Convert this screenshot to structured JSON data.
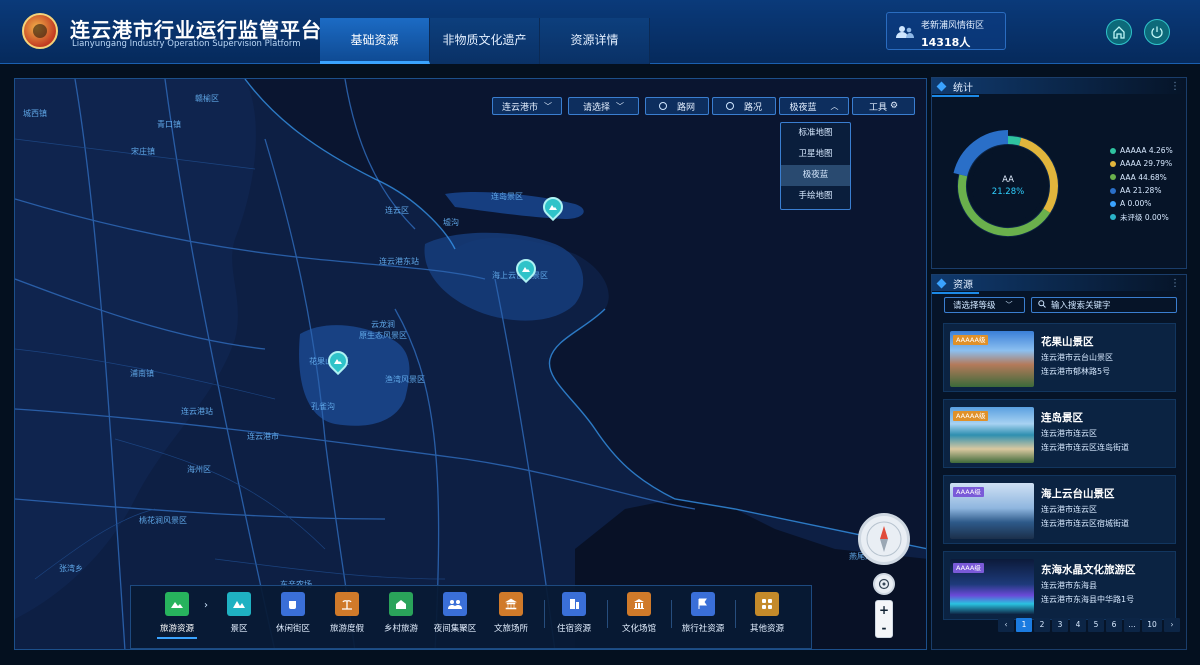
{
  "header": {
    "title": "连云港市行业运行监管平台",
    "subtitle": "Lianyungang Industry Operation Supervision Platform",
    "tabs": [
      {
        "label": "基础资源",
        "active": true
      },
      {
        "label": "非物质文化遗产",
        "active": false
      },
      {
        "label": "资源详情",
        "active": false
      }
    ],
    "visitor_box": {
      "label": "老新浦风情街区",
      "count": "14318人"
    },
    "icons": [
      "home-icon",
      "power-icon"
    ]
  },
  "map": {
    "controls": {
      "city_select": "连云港市",
      "area_select": "请选择",
      "road_net": "路网",
      "road_status": "路况",
      "map_style": "极夜蓝",
      "tools": "工具"
    },
    "style_options": [
      {
        "label": "标准地图",
        "selected": false
      },
      {
        "label": "卫星地图",
        "selected": false
      },
      {
        "label": "极夜蓝",
        "selected": true
      },
      {
        "label": "手绘地图",
        "selected": false
      }
    ],
    "places": [
      "赣榆区",
      "城西镇",
      "青口镇",
      "宋庄镇",
      "墟沟",
      "连岛景区",
      "连云区",
      "连云港东站",
      "海上云台山景区",
      "云龙涧",
      "原生态风景区",
      "花果山景区",
      "渔湾风景区",
      "孔雀沟",
      "浦南镇",
      "连云港站",
      "连云港市",
      "海州区",
      "桃花涧风景区",
      "张湾乡",
      "东辛农场",
      "燕尾港"
    ],
    "zoom_in": "+",
    "zoom_out": "-"
  },
  "categories": [
    {
      "label": "旅游资源",
      "icon": "landscape-icon",
      "color": "#27b35d",
      "active": true
    },
    {
      "label": "景区",
      "icon": "mountain-icon",
      "color": "#1fb1c2",
      "active": false
    },
    {
      "label": "休闲街区",
      "icon": "cup-icon",
      "color": "#3a6fd8",
      "active": false
    },
    {
      "label": "旅游度假",
      "icon": "palm-icon",
      "color": "#d07a2a",
      "active": false
    },
    {
      "label": "乡村旅游",
      "icon": "house-icon",
      "color": "#2aa35a",
      "active": false
    },
    {
      "label": "夜间集聚区",
      "icon": "people-icon",
      "color": "#3a6fd8",
      "active": false
    },
    {
      "label": "文旅场所",
      "icon": "temple-icon",
      "color": "#d07a2a",
      "active": false
    },
    {
      "label": "住宿资源",
      "icon": "building-icon",
      "color": "#3a6fd8",
      "active": false
    },
    {
      "label": "文化场馆",
      "icon": "museum-icon",
      "color": "#d07a2a",
      "active": false
    },
    {
      "label": "旅行社资源",
      "icon": "flag-icon",
      "color": "#3a6fd8",
      "active": false
    },
    {
      "label": "其他资源",
      "icon": "grid-icon",
      "color": "#c48a2a",
      "active": false
    }
  ],
  "stats_panel": {
    "title": "统计",
    "center_label": "AA",
    "center_value": "21.28%",
    "legend": [
      {
        "label": "AAAAA 4.26%",
        "color": "#2fc3a0"
      },
      {
        "label": "AAAA 29.79%",
        "color": "#e1b53c"
      },
      {
        "label": "AAA 44.68%",
        "color": "#6ab04c"
      },
      {
        "label": "AA 21.28%",
        "color": "#2a6fc8"
      },
      {
        "label": "A 0.00%",
        "color": "#3aa3ff"
      },
      {
        "label": "未评级 0.00%",
        "color": "#2ab3c9"
      }
    ]
  },
  "chart_data": {
    "type": "pie",
    "categories": [
      "AAAAA",
      "AAAA",
      "AAA",
      "AA",
      "A",
      "未评级"
    ],
    "values": [
      4.26,
      29.79,
      44.68,
      21.28,
      0.0,
      0.0
    ],
    "title": "",
    "highlight": "AA"
  },
  "resources_panel": {
    "title": "资源",
    "level_select": "请选择等级",
    "search_placeholder": "输入搜索关键字",
    "items": [
      {
        "badge": "AAAAA级",
        "badge_color": "#e0912a",
        "name": "花果山景区",
        "city": "连云港市云台山景区",
        "address": "连云港市郁林路5号"
      },
      {
        "badge": "AAAAA级",
        "badge_color": "#e0912a",
        "name": "连岛景区",
        "city": "连云港市连云区",
        "address": "连云港市连云区连岛街道"
      },
      {
        "badge": "AAAA级",
        "badge_color": "#7a5ad8",
        "name": "海上云台山景区",
        "city": "连云港市连云区",
        "address": "连云港市连云区宿城街道"
      },
      {
        "badge": "AAAA级",
        "badge_color": "#7a5ad8",
        "name": "东海水晶文化旅游区",
        "city": "连云港市东海县",
        "address": "连云港市东海县中华路1号"
      }
    ],
    "pager": [
      "‹",
      "1",
      "2",
      "3",
      "4",
      "5",
      "6",
      "…",
      "10",
      "›"
    ],
    "current_page": "1"
  }
}
